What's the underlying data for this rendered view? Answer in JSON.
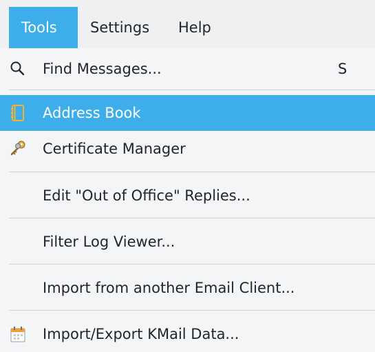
{
  "menubar": {
    "items": [
      {
        "label": "Tools"
      },
      {
        "label": "Settings"
      },
      {
        "label": "Help"
      }
    ]
  },
  "menu": {
    "items": [
      {
        "label": "Find Messages...",
        "shortcut": "S",
        "icon": "search-icon"
      },
      {
        "label": "Address Book",
        "icon": "address-book-icon"
      },
      {
        "label": "Certificate Manager",
        "icon": "keys-icon"
      },
      {
        "label": "Edit \"Out of Office\" Replies..."
      },
      {
        "label": "Filter Log Viewer..."
      },
      {
        "label": "Import from another Email Client..."
      },
      {
        "label": "Import/Export KMail Data...",
        "icon": "calendar-import-icon"
      }
    ]
  },
  "colors": {
    "highlight": "#3daee9",
    "menu_bg": "#f4f5f6",
    "text": "#232629"
  }
}
